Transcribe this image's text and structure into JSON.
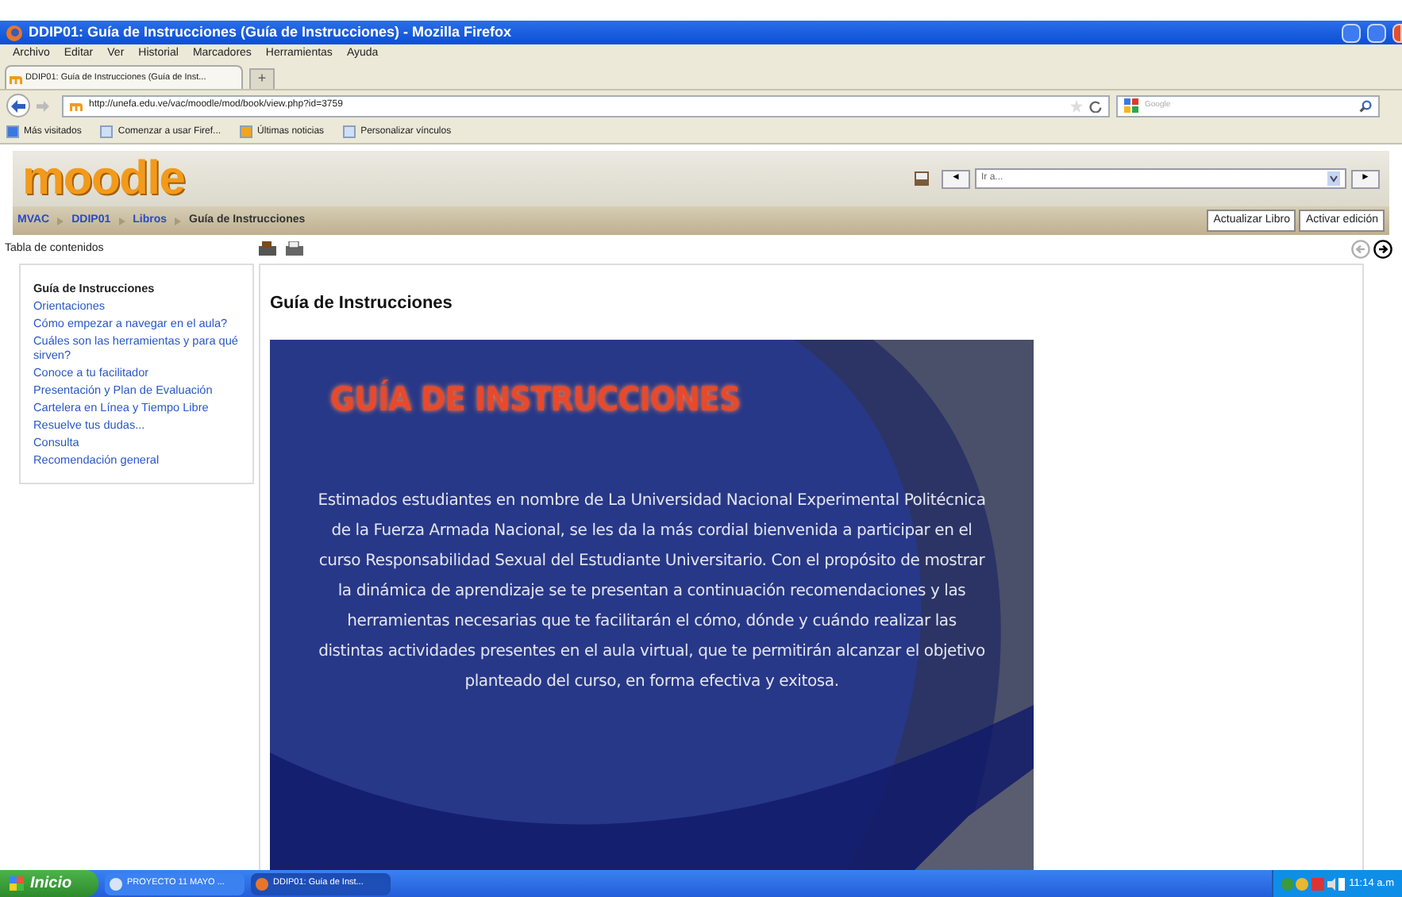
{
  "window": {
    "title": "DDIP01: Guía de Instrucciones (Guía de Instrucciones) - Mozilla Firefox"
  },
  "menu": [
    "Archivo",
    "Editar",
    "Ver",
    "Historial",
    "Marcadores",
    "Herramientas",
    "Ayuda"
  ],
  "tabs": [
    {
      "label": "DDIP01: Guía de Instrucciones (Guía de Inst...",
      "selected": true
    }
  ],
  "new_tab": "+",
  "address": {
    "value": "http://unefa.edu.ve/vac/moodle/mod/book/view.php?id=3759"
  },
  "search": {
    "placeholder": "Google"
  },
  "bookmarks": [
    {
      "label": "Más visitados",
      "kind": "smart"
    },
    {
      "label": "Comenzar a usar Firef...",
      "kind": "page"
    },
    {
      "label": "Últimas noticias",
      "kind": "feed"
    },
    {
      "label": "Personalizar vínculos",
      "kind": "page"
    }
  ],
  "moodle": {
    "logo": "moodle",
    "jump": {
      "prev": "◄",
      "placeholder": "Ir a...",
      "next": "►"
    },
    "breadcrumb": [
      {
        "label": "MVAC",
        "link": true
      },
      {
        "label": "DDIP01",
        "link": true
      },
      {
        "label": "Libros",
        "link": true
      },
      {
        "label": "Guía de Instrucciones",
        "link": false
      }
    ],
    "buttons": [
      "Actualizar Libro",
      "Activar edición"
    ],
    "toc_title": "Tabla de contenidos",
    "toc": [
      {
        "label": "Guía de Instrucciones",
        "selected": true
      },
      {
        "label": "Orientaciones",
        "selected": false
      },
      {
        "label": "Cómo empezar a navegar en el aula?",
        "selected": false
      },
      {
        "label": "Cuáles son las herramientas y para qué sirven?",
        "selected": false
      },
      {
        "label": "Conoce a tu facilitador",
        "selected": false
      },
      {
        "label": "Presentación y Plan de Evaluación",
        "selected": false
      },
      {
        "label": "Cartelera en Línea y Tiempo Libre",
        "selected": false
      },
      {
        "label": "Resuelve tus dudas...",
        "selected": false
      },
      {
        "label": "Consulta",
        "selected": false
      },
      {
        "label": "Recomendación general",
        "selected": false
      }
    ],
    "nav": {
      "prev_disabled": true,
      "next_disabled": false
    },
    "chapter_title": "Guía de Instrucciones",
    "slide": {
      "title": "GUÍA DE INSTRUCCIONES",
      "body": "Estimados estudiantes en nombre de La Universidad Nacional Experimental Politécnica de la Fuerza Armada Nacional, se les da la  más cordial bienvenida a participar en el curso Responsabilidad Sexual del Estudiante Universitario. Con el propósito de mostrar la dinámica de aprendizaje se te presentan a continuación recomendaciones y las herramientas necesarias que te facilitarán el cómo, dónde y cuándo realizar las distintas actividades presentes en el aula virtual, que te permitirán alcanzar el objetivo planteado del curso, en forma efectiva y exitosa."
    }
  },
  "taskbar": {
    "start": "Inicio",
    "tasks": [
      {
        "label": "PROYECTO 11 MAYO ...",
        "selected": false
      },
      {
        "label": "DDIP01: Guía de Inst...",
        "selected": true
      }
    ],
    "clock": "11:14 a.m"
  }
}
